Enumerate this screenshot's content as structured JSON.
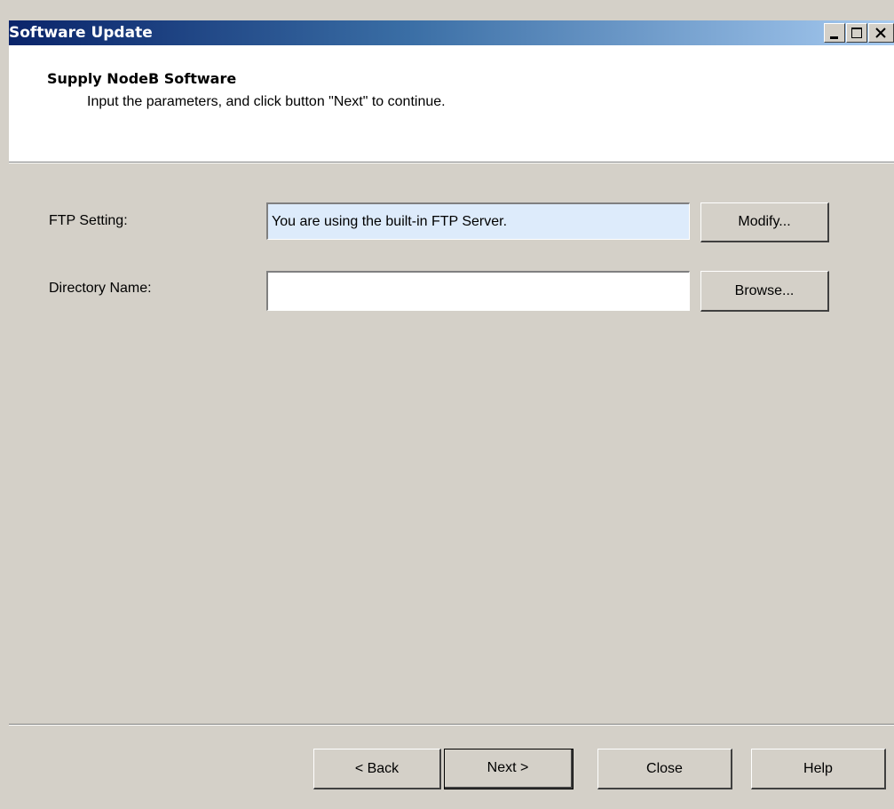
{
  "window": {
    "title": "Software Update",
    "controls": {
      "minimize_icon": "minimize-icon",
      "maximize_icon": "maximize-icon",
      "close_icon": "close-icon"
    }
  },
  "header": {
    "title": "Supply NodeB Software",
    "subtitle": "Input the parameters, and click button \"Next\" to continue."
  },
  "form": {
    "ftp_setting": {
      "label": "FTP Setting:",
      "value": "You are using the built-in FTP Server.",
      "button_label": "Modify..."
    },
    "directory_name": {
      "label": "Directory Name:",
      "value": "",
      "button_label": "Browse..."
    }
  },
  "footer": {
    "back_label": "< Back",
    "next_label": "Next >",
    "close_label": "Close",
    "help_label": "Help"
  },
  "colors": {
    "title_gradient_start": "#0a246a",
    "title_gradient_end": "#a6caf0",
    "dialog_face": "#d4d0c8",
    "ftp_field_bg": "#ddebfb"
  }
}
